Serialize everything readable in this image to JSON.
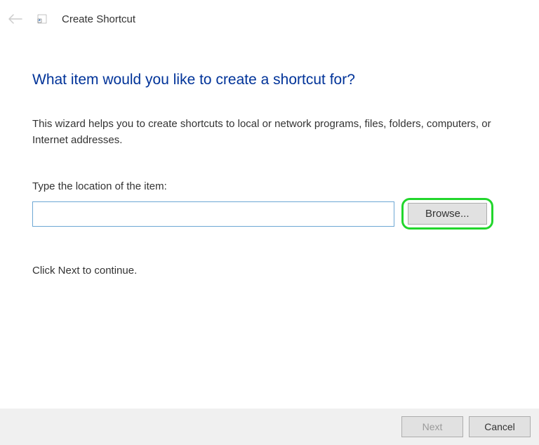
{
  "header": {
    "title": "Create Shortcut"
  },
  "main": {
    "heading": "What item would you like to create a shortcut for?",
    "description": "This wizard helps you to create shortcuts to local or network programs, files, folders, computers, or Internet addresses.",
    "field_label": "Type the location of the item:",
    "location_value": "",
    "browse_label": "Browse...",
    "continue_text": "Click Next to continue."
  },
  "footer": {
    "next_label": "Next",
    "cancel_label": "Cancel"
  }
}
